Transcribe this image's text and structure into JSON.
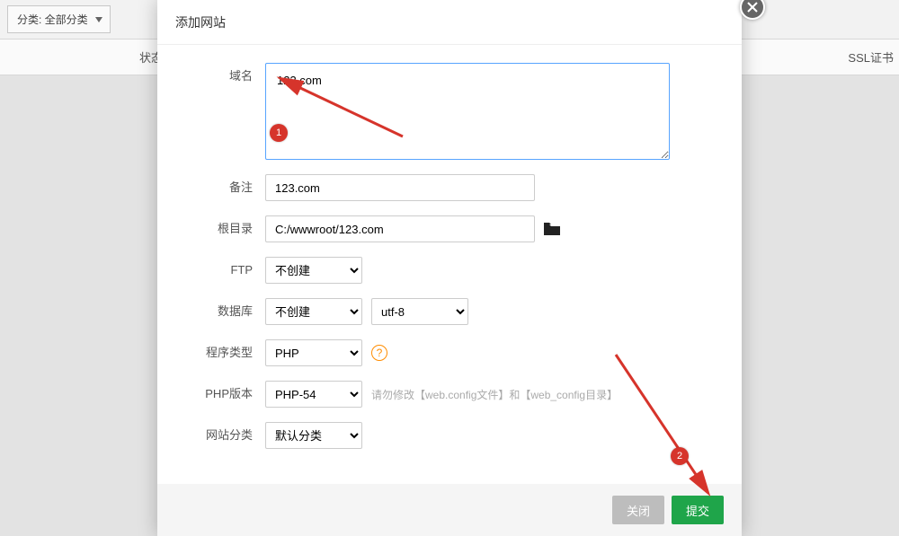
{
  "background": {
    "category_label": "分类: 全部分类",
    "col_status": "状态",
    "col_ssl": "SSL证书"
  },
  "modal": {
    "title": "添加网站",
    "labels": {
      "domain": "域名",
      "remark": "备注",
      "root": "根目录",
      "ftp": "FTP",
      "database": "数据库",
      "program_type": "程序类型",
      "php_version": "PHP版本",
      "site_category": "网站分类"
    },
    "values": {
      "domain": "123.com",
      "remark": "123.com",
      "root": "C:/wwwroot/123.com",
      "ftp": "不创建",
      "database": "不创建",
      "db_charset": "utf-8",
      "program_type": "PHP",
      "php_version": "PHP-54",
      "site_category": "默认分类"
    },
    "hints": {
      "php_version": "请勿修改【web.config文件】和【web_config目录】"
    },
    "buttons": {
      "close": "关闭",
      "submit": "提交"
    }
  },
  "annotations": {
    "badge1": "1",
    "badge2": "2"
  }
}
